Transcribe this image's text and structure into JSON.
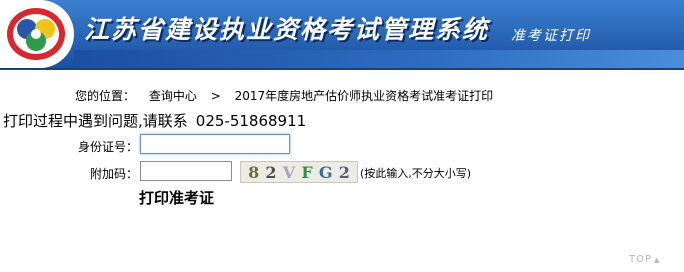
{
  "header": {
    "title": "江苏省建设执业资格考试管理系统",
    "subtitle": "准考证打印",
    "logo_icon": "jiangsu-construction-emblem"
  },
  "breadcrumb": {
    "prefix": "您的位置：",
    "home": "查询中心",
    "separator": ">",
    "current": "2017年度房地产估价师执业资格考试准考证打印"
  },
  "contact": {
    "text": "打印过程中遇到问题,请联系",
    "phone": "025-51868911"
  },
  "form": {
    "id_label": "身份证号：",
    "id_value": "",
    "code_label": "附加码：",
    "code_value": "",
    "captcha_chars": [
      {
        "char": "8",
        "color": "#6f6d3a"
      },
      {
        "char": "2",
        "color": "#4e4e4e"
      },
      {
        "char": "V",
        "color": "#a4a4c6"
      },
      {
        "char": "F",
        "color": "#2f8f4a"
      },
      {
        "char": "G",
        "color": "#3b6f8c"
      },
      {
        "char": "2",
        "color": "#5b5b78"
      }
    ],
    "hint": "(按此输入,不分大小写)",
    "print_label": "打印准考证"
  },
  "footer": {
    "top_label": "TOP",
    "top_arrow": "▲"
  },
  "colors": {
    "header_blue": "#1c4f9f",
    "focus_border": "#6a8fc7"
  }
}
